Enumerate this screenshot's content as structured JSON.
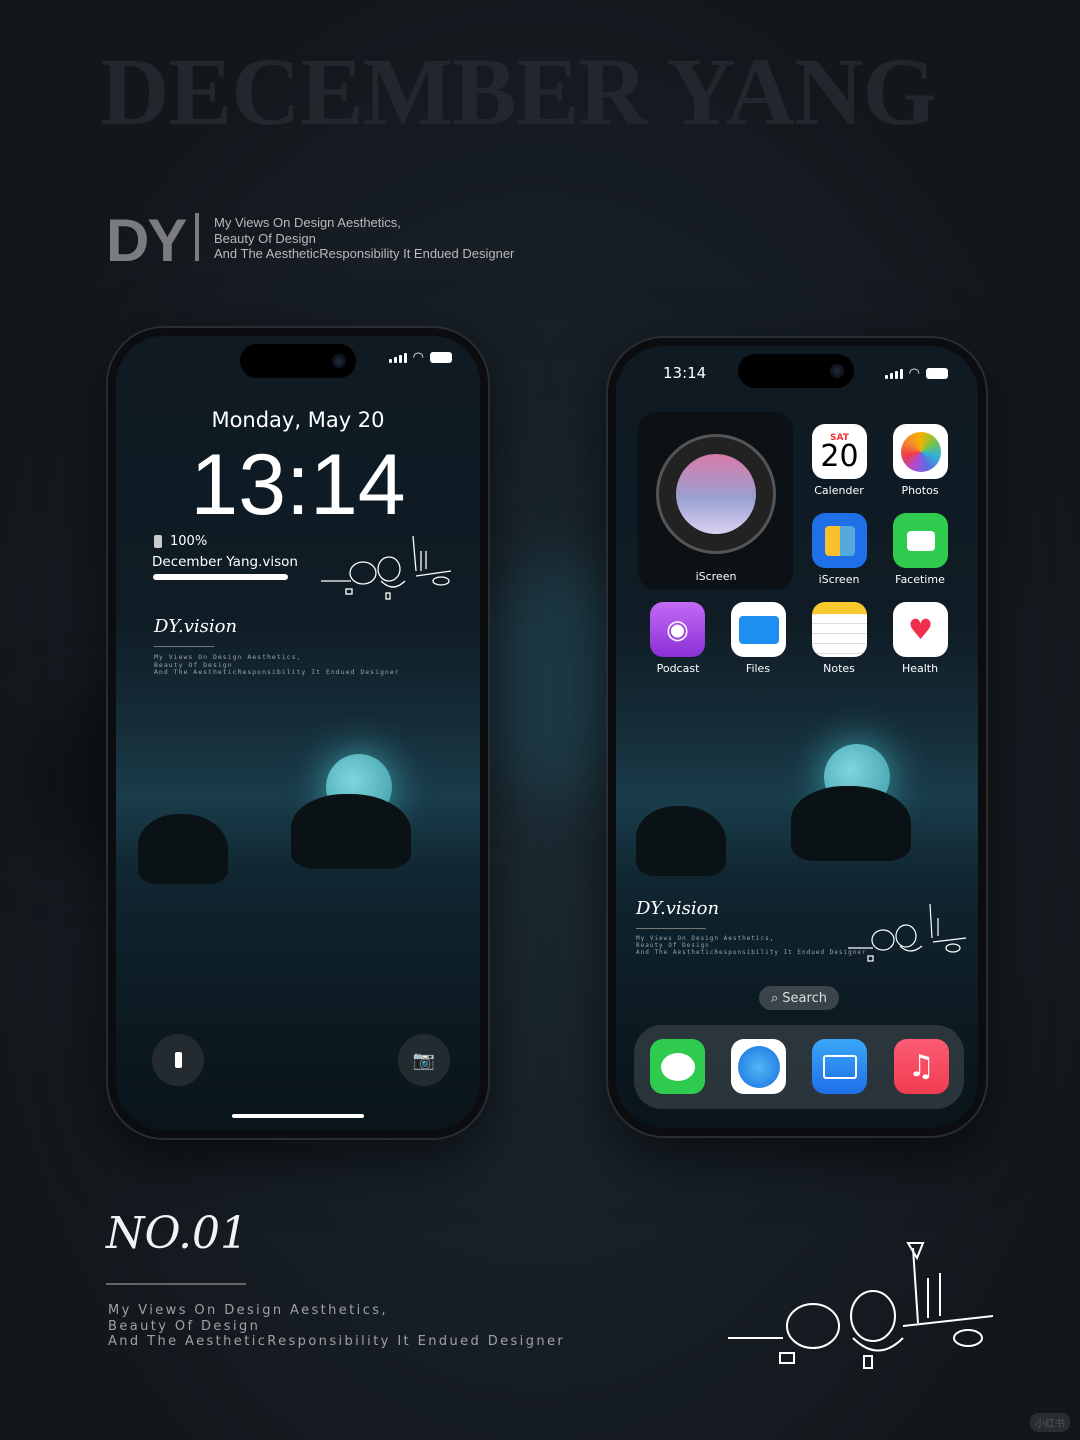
{
  "poster": {
    "big_title": "DECEMBER YANG",
    "logo": "DY",
    "tagline": [
      "My Views On Design Aesthetics,",
      "Beauty Of Design",
      "And The AestheticResponsibility It Endued Designer"
    ],
    "number": "NO.01",
    "watermark": "小红书"
  },
  "lock_screen": {
    "date": "Monday, May 20",
    "time": "13:14",
    "battery": "100%",
    "widget_name": "December Yang.vison",
    "brand": "DY.vision",
    "tagline": [
      "My Views On Design Aesthetics,",
      "Beauty Of Design",
      "And The AestheticResponsibility It Endued Designer"
    ],
    "flashlight_icon": "flashlight-icon",
    "camera_icon": "camera-icon"
  },
  "home_screen": {
    "time": "13:14",
    "widget_label": "iScreen",
    "calendar": {
      "day": "SAT",
      "date": "20"
    },
    "apps": [
      {
        "label": "Calender"
      },
      {
        "label": "Photos"
      },
      {
        "label": "iScreen"
      },
      {
        "label": "Facetime"
      },
      {
        "label": "Podcast"
      },
      {
        "label": "Files"
      },
      {
        "label": "Notes"
      },
      {
        "label": "Health"
      }
    ],
    "brand": "DY.vision",
    "tagline": [
      "My Views On Design Aesthetics,",
      "Beauty Of Design",
      "And The AestheticResponsibility It Endued Designer"
    ],
    "search": "Search",
    "dock": [
      "messages",
      "safari",
      "mail",
      "music"
    ]
  },
  "colors": {
    "background": "#161a20",
    "accent": "#3fa6b3"
  }
}
